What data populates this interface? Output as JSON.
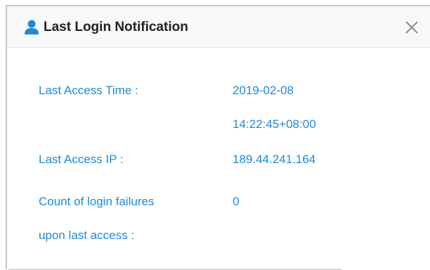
{
  "dialog": {
    "title": "Last Login Notification",
    "header_icon": "user-icon",
    "close_icon": "close-icon",
    "accent_color": "#1e8ad6"
  },
  "details": {
    "last_access_time_label": "Last Access Time :",
    "last_access_date": "2019-02-08",
    "last_access_time": "14:22:45+08:00",
    "last_access_ip_label": "Last Access IP :",
    "last_access_ip": "189.44.241.164",
    "login_failures_label_line1": "Count of login failures",
    "login_failures_label_line2": "upon last access :",
    "login_failures_count": "0"
  }
}
